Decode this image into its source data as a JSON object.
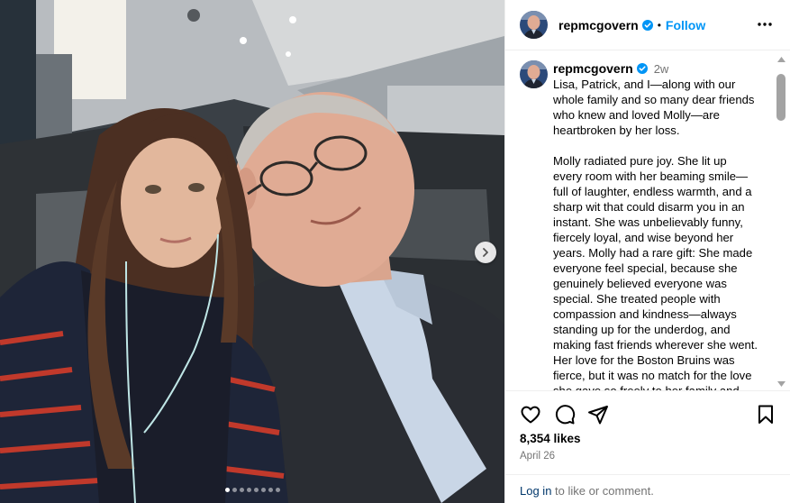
{
  "post": {
    "username": "repmcgovern",
    "verified": true,
    "follow_label": "Follow",
    "separator": "•",
    "more_icon": "more-horizontal-icon",
    "time_ago": "2w",
    "caption_paragraphs": [
      "Lisa, Patrick, and I—along with our whole family and so many dear friends who knew and loved Molly—are heartbroken by her loss.",
      "Molly radiated pure joy. She lit up every room with her beaming smile—full of laughter, endless warmth, and a sharp wit that could disarm you in an instant. She was unbelievably funny, fiercely loyal, and wise beyond her years. Molly had a rare gift: She made everyone feel special, because she genuinely believed everyone was special. She treated people with compassion and kindness—always standing up for the underdog, and making fast friends wherever she went. Her love for the Boston Bruins was fierce, but it was no match for the love she gave so freely to her family and"
    ],
    "likes": "8,354 likes",
    "date": "April 26",
    "login_link": "Log in",
    "login_suffix": " to like or comment.",
    "carousel": {
      "slides": 8,
      "active_index": 0
    },
    "icons": {
      "like": "heart-icon",
      "comment": "comment-icon",
      "share": "share-icon",
      "save": "bookmark-icon",
      "next": "chevron-right-icon"
    },
    "colors": {
      "accent": "#0095f6",
      "verified": "#0095f6",
      "link": "#00376b",
      "muted": "#737373"
    }
  }
}
